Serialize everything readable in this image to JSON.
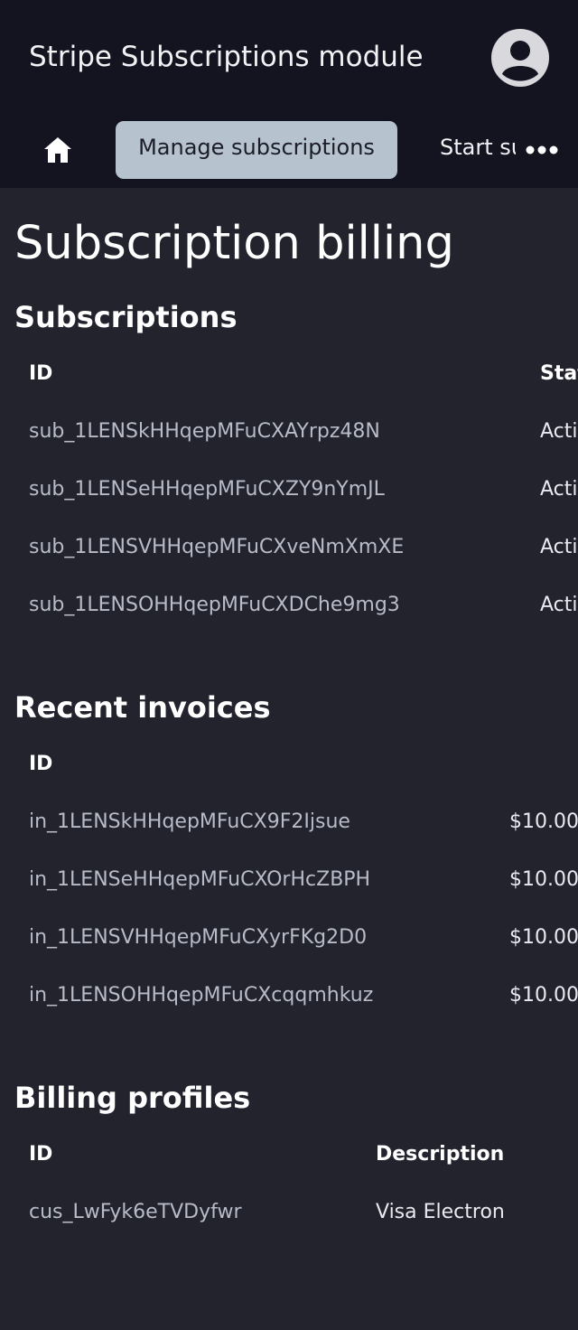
{
  "header": {
    "app_title": "Stripe Subscriptions module",
    "avatar_icon": "account-circle-icon"
  },
  "nav": {
    "home_icon": "home-icon",
    "active_tab": "Manage subscriptions",
    "next_tab": "Start subscription",
    "more_icon": "more-horizontal-icon"
  },
  "page": {
    "title": "Subscription billing"
  },
  "subscriptions": {
    "title": "Subscriptions",
    "columns": [
      "ID",
      "Status"
    ],
    "rows": [
      {
        "id": "sub_1LENSkHHqepMFuCXAYrpz48N",
        "status": "Active"
      },
      {
        "id": "sub_1LENSeHHqepMFuCXZY9nYmJL",
        "status": "Active"
      },
      {
        "id": "sub_1LENSVHHqepMFuCXveNmXmXE",
        "status": "Active"
      },
      {
        "id": "sub_1LENSOHHqepMFuCXDChe9mg3",
        "status": "Active"
      }
    ]
  },
  "invoices": {
    "title": "Recent invoices",
    "columns": [
      "ID",
      ""
    ],
    "rows": [
      {
        "id": "in_1LENSkHHqepMFuCX9F2Ijsue",
        "amount": "$10.00"
      },
      {
        "id": "in_1LENSeHHqepMFuCXOrHcZBPH",
        "amount": "$10.00"
      },
      {
        "id": "in_1LENSVHHqepMFuCXyrFKg2D0",
        "amount": "$10.00"
      },
      {
        "id": "in_1LENSOHHqepMFuCXcqqmhkuz",
        "amount": "$10.00"
      }
    ]
  },
  "billing_profiles": {
    "title": "Billing profiles",
    "columns": [
      "ID",
      "Description"
    ],
    "rows": [
      {
        "id": "cus_LwFyk6eTVDyfwr",
        "description": "Visa Electron"
      }
    ]
  },
  "colors": {
    "background": "#22232d",
    "topbar": "#131420",
    "active_tab": "#b7c2cf"
  }
}
